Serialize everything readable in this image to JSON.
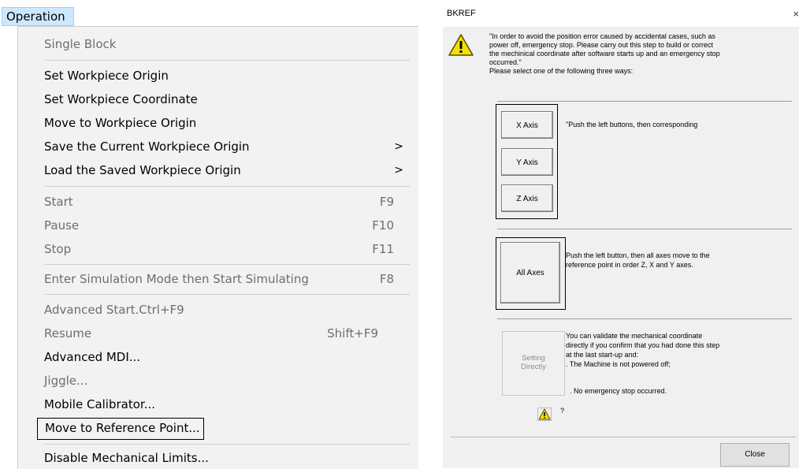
{
  "menu": {
    "title": "Operation",
    "items": [
      {
        "label": "Single Block",
        "shortcut": "",
        "arrow": "",
        "disabled": true
      },
      {
        "label": "Set Workpiece Origin",
        "shortcut": "",
        "arrow": "",
        "disabled": false
      },
      {
        "label": "Set Workpiece Coordinate",
        "shortcut": "",
        "arrow": "",
        "disabled": false
      },
      {
        "label": "Move to Workpiece Origin",
        "shortcut": "",
        "arrow": "",
        "disabled": false
      },
      {
        "label": "Save the Current Workpiece Origin",
        "shortcut": "",
        "arrow": ">",
        "disabled": false
      },
      {
        "label": "Load the Saved Workpiece Origin",
        "shortcut": "",
        "arrow": ">",
        "disabled": false
      },
      {
        "label": "Start",
        "shortcut": "F9",
        "arrow": "",
        "disabled": true
      },
      {
        "label": "Pause",
        "shortcut": "F10",
        "arrow": "",
        "disabled": true
      },
      {
        "label": "Stop",
        "shortcut": "F11",
        "arrow": "",
        "disabled": true
      },
      {
        "label": "Enter Simulation Mode then Start Simulating",
        "shortcut": "F8",
        "arrow": "",
        "disabled": true
      },
      {
        "label": "Advanced Start.Ctrl+F9",
        "shortcut": "",
        "arrow": "",
        "disabled": true
      },
      {
        "label": "Resume",
        "shortcut": "Shift+F9",
        "arrow": "",
        "disabled": true
      },
      {
        "label": "Advanced MDI...",
        "shortcut": "",
        "arrow": "",
        "disabled": false
      },
      {
        "label": "Jiggle...",
        "shortcut": "",
        "arrow": "",
        "disabled": true
      },
      {
        "label": "Mobile Calibrator...",
        "shortcut": "",
        "arrow": "",
        "disabled": false
      },
      {
        "label": "Move to Reference Point...",
        "shortcut": "",
        "arrow": "",
        "disabled": false
      },
      {
        "label": "Disable Mechanical Limits...",
        "shortcut": "",
        "arrow": "",
        "disabled": false
      }
    ]
  },
  "dialog": {
    "title": "BKREF",
    "close_x": "×",
    "intro_lines": [
      "\"In order to avoid the position error caused by accidental cases, such as",
      "power off, emergency stop. Please carry out this step to build or correct",
      "the mechinical coordinate after software starts up and an emergency stop",
      "occurred.\"",
      "Please select one of the following three ways:"
    ],
    "axis_buttons": {
      "x": "X Axis",
      "y": "Y Axis",
      "z": "Z Axis"
    },
    "axis_text": "\"Push the left buttons, then corresponding",
    "all_axes_button": "All Axes",
    "all_axes_text": [
      "Push the left button, then all axes move to the",
      "reference point in order Z, X and Y axes."
    ],
    "setting_button": [
      "Setting",
      "Directly"
    ],
    "setting_text": [
      "You can validate the mechanical coordinate",
      "directly if you confirm that you had done this step",
      "at the last start-up and:",
      ". The Machine is not powered off;"
    ],
    "no_emergency_text": ". No emergency stop occurred.",
    "question_mark": "?",
    "close_button": "Close"
  },
  "colors": {
    "menubar_highlight": "#cce8ff",
    "menu_background": "#f2f2f2",
    "dialog_background": "#f0f0f0",
    "warning_yellow": "#f5e000"
  }
}
